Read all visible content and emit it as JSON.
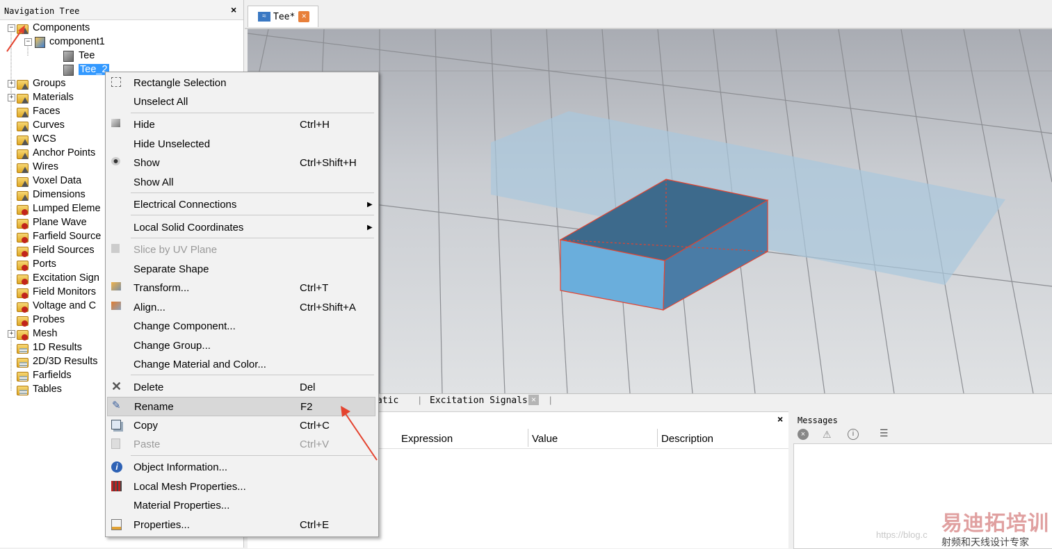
{
  "nav": {
    "title": "Navigation Tree",
    "close": "×",
    "items": [
      {
        "label": "Components",
        "expander": "−"
      },
      {
        "label": "component1",
        "expander": "−"
      },
      {
        "label": "Tee"
      },
      {
        "label": "Tee_2"
      },
      {
        "label": "Groups",
        "expander": "+"
      },
      {
        "label": "Materials",
        "expander": "+"
      },
      {
        "label": "Faces"
      },
      {
        "label": "Curves"
      },
      {
        "label": "WCS"
      },
      {
        "label": "Anchor Points"
      },
      {
        "label": "Wires"
      },
      {
        "label": "Voxel Data"
      },
      {
        "label": "Dimensions"
      },
      {
        "label": "Lumped Eleme"
      },
      {
        "label": "Plane Wave"
      },
      {
        "label": "Farfield Source"
      },
      {
        "label": "Field Sources"
      },
      {
        "label": "Ports"
      },
      {
        "label": "Excitation Sign"
      },
      {
        "label": "Field Monitors"
      },
      {
        "label": "Voltage and C"
      },
      {
        "label": "Probes"
      },
      {
        "label": "Mesh",
        "expander": "+"
      },
      {
        "label": "1D Results"
      },
      {
        "label": "2D/3D Results"
      },
      {
        "label": "Farfields"
      },
      {
        "label": "Tables"
      }
    ]
  },
  "tabs": {
    "active": "Tee*",
    "close": "×"
  },
  "lower_tabs": {
    "partial": "atic",
    "excitation": "Excitation Signals",
    "close": "×"
  },
  "params": {
    "close": "×",
    "col_expression": "Expression",
    "col_value": "Value",
    "col_description": "Description"
  },
  "messages": {
    "title": "Messages"
  },
  "context_menu": {
    "items": [
      {
        "label": "Rectangle Selection",
        "shortcut": ""
      },
      {
        "label": "Unselect All",
        "shortcut": ""
      },
      {
        "label": "Hide",
        "shortcut": "Ctrl+H"
      },
      {
        "label": "Hide Unselected",
        "shortcut": ""
      },
      {
        "label": "Show",
        "shortcut": "Ctrl+Shift+H"
      },
      {
        "label": "Show All",
        "shortcut": ""
      },
      {
        "label": "Electrical Connections",
        "shortcut": ""
      },
      {
        "label": "Local Solid Coordinates",
        "shortcut": ""
      },
      {
        "label": "Slice by UV Plane",
        "shortcut": "",
        "disabled": true
      },
      {
        "label": "Separate Shape",
        "shortcut": ""
      },
      {
        "label": "Transform...",
        "shortcut": "Ctrl+T"
      },
      {
        "label": "Align...",
        "shortcut": "Ctrl+Shift+A"
      },
      {
        "label": "Change Component...",
        "shortcut": ""
      },
      {
        "label": "Change Group...",
        "shortcut": ""
      },
      {
        "label": "Change Material and Color...",
        "shortcut": ""
      },
      {
        "label": "Delete",
        "shortcut": "Del"
      },
      {
        "label": "Rename",
        "shortcut": "F2",
        "highlighted": true
      },
      {
        "label": "Copy",
        "shortcut": "Ctrl+C"
      },
      {
        "label": "Paste",
        "shortcut": "Ctrl+V",
        "disabled": true
      },
      {
        "label": "Object Information...",
        "shortcut": ""
      },
      {
        "label": "Local Mesh Properties...",
        "shortcut": ""
      },
      {
        "label": "Material Properties...",
        "shortcut": ""
      },
      {
        "label": "Properties...",
        "shortcut": "Ctrl+E"
      }
    ]
  },
  "watermark": {
    "brand": "易迪拓培训",
    "tagline": "射频和天线设计专家",
    "url": "https://blog.c"
  },
  "colors": {
    "accent_red": "#e4432f",
    "selection_blue": "#3399ff",
    "solid_blue": "#5a9fcf"
  }
}
